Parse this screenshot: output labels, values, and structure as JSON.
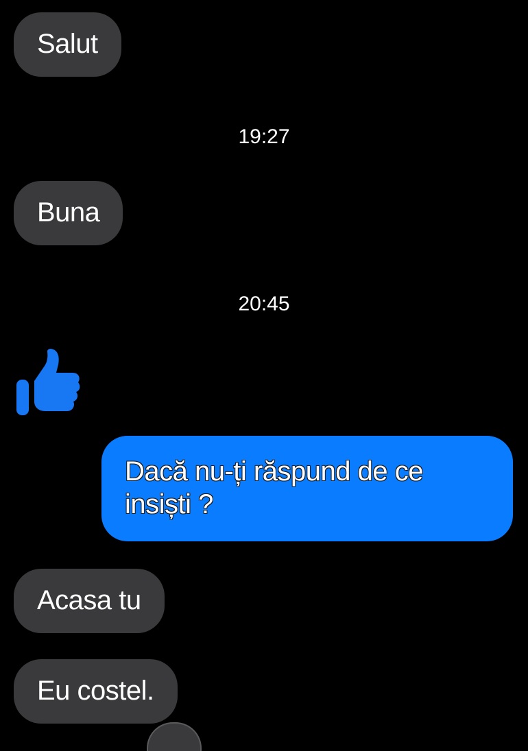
{
  "conversation": {
    "messages": [
      {
        "from": "them",
        "text": "Salut"
      },
      {
        "from": "them",
        "text": "Buna"
      },
      {
        "from": "them",
        "reaction": "thumbs-up-icon"
      },
      {
        "from": "me",
        "text": "Dacă nu-ți răspund de ce insiști ?"
      },
      {
        "from": "them",
        "text": "Acasa tu"
      },
      {
        "from": "them",
        "text": "Eu costel."
      }
    ],
    "timestamps": [
      "19:27",
      "20:45"
    ]
  },
  "colors": {
    "background": "#000000",
    "incoming_bubble": "#3a3a3c",
    "outgoing_bubble": "#0a7cff",
    "like_icon": "#1877f2"
  }
}
